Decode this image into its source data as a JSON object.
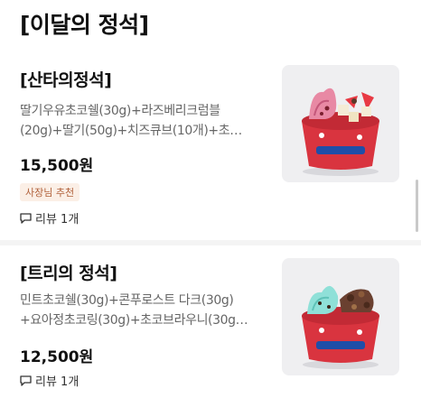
{
  "section": {
    "title": "[이달의 정석]"
  },
  "items": [
    {
      "name": "[산타의정석]",
      "desc_lines": [
        "딸기우유초코쉘(30g)+라즈베리크럼블",
        "(20g)+딸기(50g)+치즈큐브(10개)+초…"
      ],
      "price": "15,500원",
      "badge": "사장님 추천",
      "review": "리뷰 1개",
      "image_icon": "ice-cream-cup-strawberry"
    },
    {
      "name": "[트리의 정석]",
      "desc_lines": [
        "민트초코쉘(30g)+콘푸로스트 다크(30g)",
        "+요아정초코링(30g)+초코브라우니(30g…"
      ],
      "price": "12,500원",
      "review": "리뷰 1개",
      "image_icon": "ice-cream-cup-mint"
    }
  ],
  "colors": {
    "badge_bg": "#fbefe6",
    "badge_text": "#b0603a",
    "cup_red": "#d9343f",
    "mint": "#8fe0d8",
    "pink": "#e889a4"
  }
}
